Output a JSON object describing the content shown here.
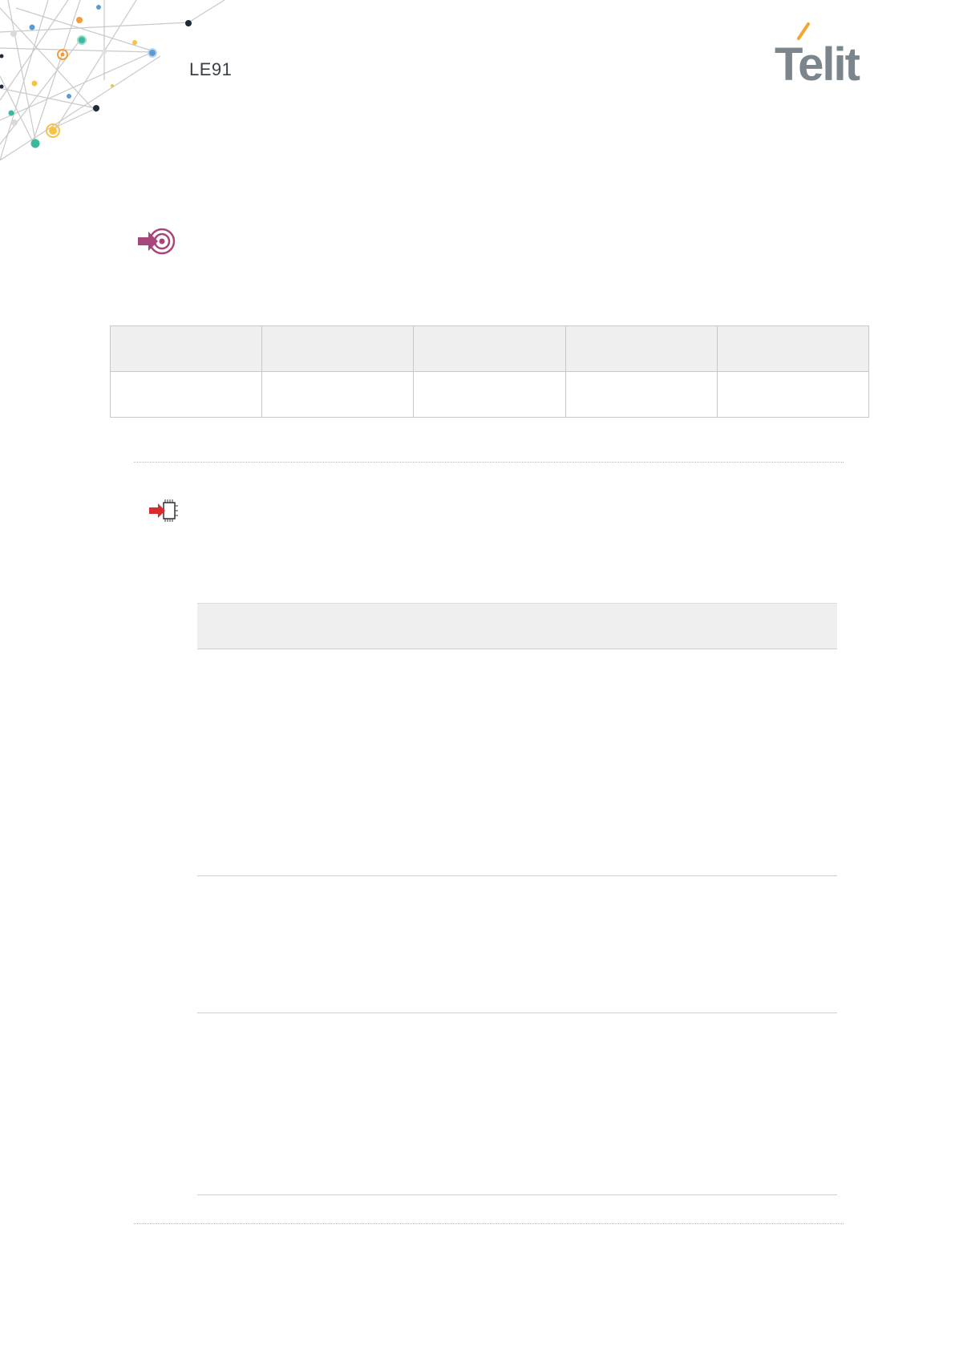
{
  "header": {
    "product": "LE91",
    "brand": "Telit"
  },
  "icons": {
    "corner_art": "network-dots-decoration",
    "target": "arrow-target-icon",
    "chip": "arrow-chip-icon"
  },
  "colors": {
    "target_icon": "#a8457a",
    "chip_arrow": "#d62c2c",
    "logo_grey": "#7b868c",
    "logo_accent": "#f0a830",
    "table_header_bg": "#efefef"
  },
  "parameter_table": {
    "columns": 5,
    "header": [
      "",
      "",
      "",
      "",
      ""
    ],
    "rows": [
      [
        "",
        "",
        "",
        "",
        ""
      ]
    ]
  },
  "detail_table": {
    "header": "",
    "rows": [
      "",
      "",
      ""
    ]
  }
}
